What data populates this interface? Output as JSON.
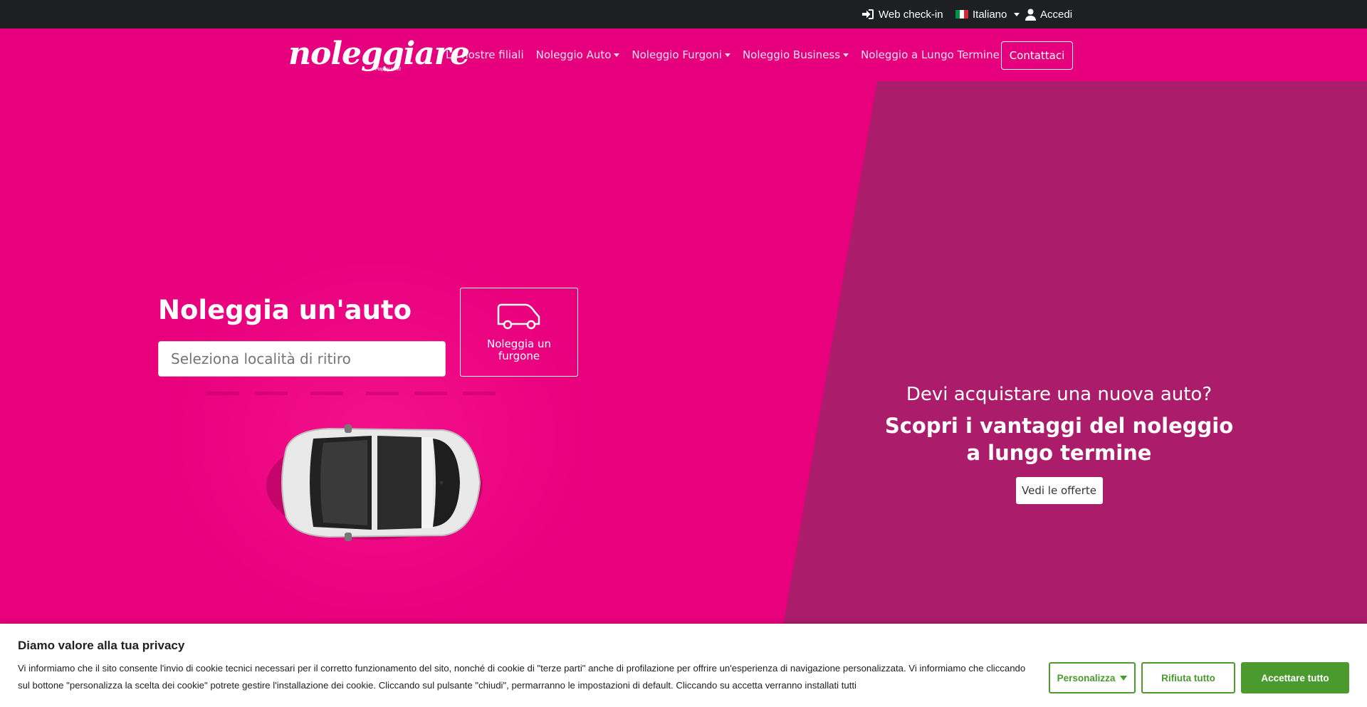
{
  "topbar": {
    "webcheck_label": "Web check-in",
    "language_label": "Italiano",
    "login_label": "Accedi"
  },
  "nav": {
    "logo_text": "noleggiare",
    "logo_tagline": "Happy rent!",
    "links": [
      {
        "label": "Le nostre filiali",
        "dropdown": false
      },
      {
        "label": "Noleggio Auto",
        "dropdown": true
      },
      {
        "label": "Noleggio Furgoni",
        "dropdown": true
      },
      {
        "label": "Noleggio Business",
        "dropdown": true
      },
      {
        "label": "Noleggio a Lungo Termine",
        "dropdown": false
      }
    ],
    "contact_label": "Contattaci"
  },
  "hero": {
    "heading": "Noleggia un'auto",
    "search_placeholder": "Seleziona località di ritiro",
    "van_button_label": "Noleggia un furgone"
  },
  "promo": {
    "question": "Devi acquistare una nuova auto?",
    "title": "Scopri i vantaggi del noleggio a lungo termine",
    "button_label": "Vedi le offerte"
  },
  "cookie": {
    "title": "Diamo valore alla tua privacy",
    "text": "Vi informiamo che il sito consente l'invio di cookie tecnici necessari per il corretto funzionamento del sito, nonché di cookie di \"terze parti\" anche di profilazione per offrire un'esperienza di navigazione personalizzata. Vi informiamo che cliccando sul bottone \"personalizza la scelta dei cookie\" potrete gestire l'installazione dei cookie. Cliccando sul pulsante \"chiudi\", permarranno le impostazioni di default. Cliccando su accetta verranno installati tutti",
    "customize_label": "Personalizza",
    "reject_label": "Rifiuta tutto",
    "accept_label": "Accettare tutto"
  },
  "colors": {
    "brand_pink": "#e8007d",
    "promo_panel": "#ab1c6a",
    "topbar": "#1d1f23",
    "cookie_green": "#4a9a2e"
  }
}
